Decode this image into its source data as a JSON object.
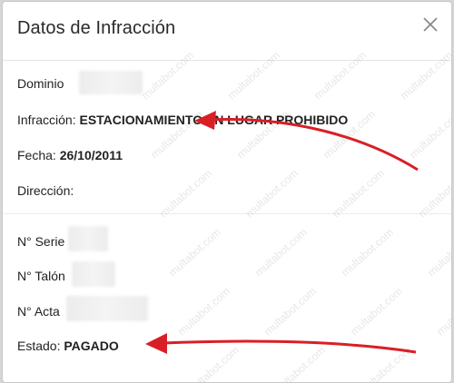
{
  "dialog": {
    "title": "Datos de Infracción",
    "close_icon": "close-icon"
  },
  "fields": {
    "dominio_label": "Dominio",
    "infraccion_label": "Infracción:",
    "infraccion_value": "ESTACIONAMIENTO EN LUGAR PROHIBIDO",
    "fecha_label": "Fecha:",
    "fecha_value": "26/10/2011",
    "direccion_label": "Dirección:",
    "serie_label": "N° Serie",
    "talon_label": "N° Talón",
    "acta_label": "N° Acta",
    "estado_label": "Estado:",
    "estado_value": "PAGADO"
  },
  "watermark": "multabot.com",
  "colors": {
    "arrow": "#d91f26",
    "text": "#222222",
    "header_border": "#e6e6e6"
  }
}
